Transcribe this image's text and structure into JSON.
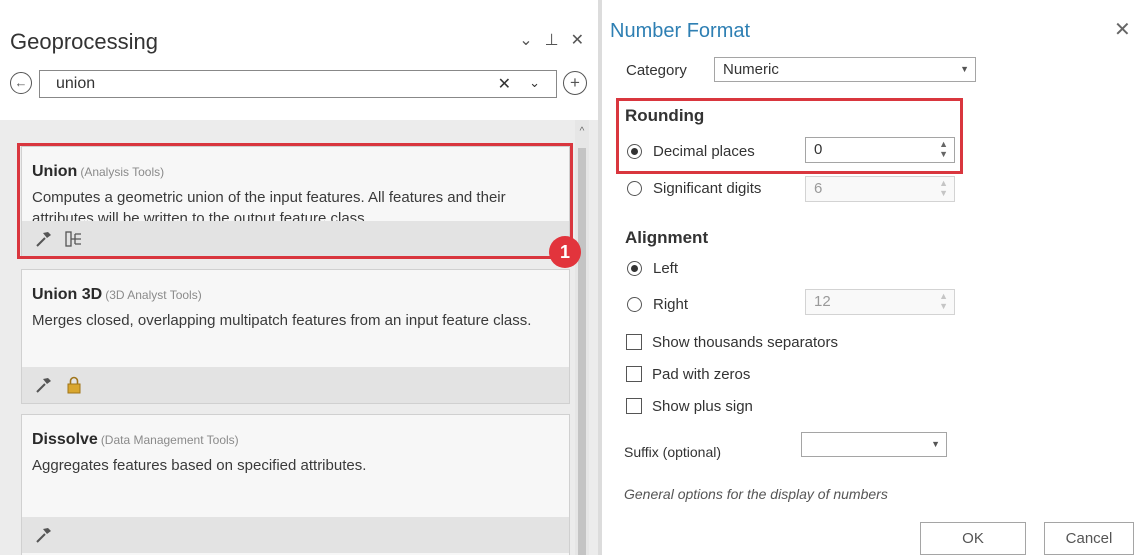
{
  "geoprocessing": {
    "title": "Geoprocessing",
    "controls": {
      "options_icon": "⌄",
      "pin_icon": "⊥",
      "close_icon": "✕"
    },
    "back_icon": "←",
    "add_icon": "+",
    "search": {
      "value": "union",
      "clear_icon": "✕",
      "dropdown_icon": "⌄"
    },
    "results": [
      {
        "name": "Union",
        "toolbox": "(Analysis Tools)",
        "description": "Computes a geometric union of the input features. All features and their attributes will be written to the output feature class.",
        "icons": [
          "hammer-icon",
          "model-icon"
        ]
      },
      {
        "name": "Union 3D",
        "toolbox": "(3D Analyst Tools)",
        "description": "Merges closed, overlapping multipatch features from an input feature class.",
        "icons": [
          "hammer-icon",
          "lock-icon"
        ]
      },
      {
        "name": "Dissolve",
        "toolbox": "(Data Management Tools)",
        "description": "Aggregates features based on specified attributes.",
        "icons": [
          "hammer-icon"
        ]
      }
    ],
    "callout_badge": "1"
  },
  "number_format": {
    "title": "Number Format",
    "close_icon": "✕",
    "category_label": "Category",
    "category_value": "Numeric",
    "rounding": {
      "heading": "Rounding",
      "decimal_places_label": "Decimal places",
      "decimal_places_value": "0",
      "significant_digits_label": "Significant digits",
      "significant_digits_value": "6",
      "selected": "decimal_places"
    },
    "alignment": {
      "heading": "Alignment",
      "left_label": "Left",
      "right_label": "Right",
      "right_width_value": "12",
      "selected": "left"
    },
    "checkboxes": [
      {
        "label": "Show thousands separators",
        "checked": false
      },
      {
        "label": "Pad with zeros",
        "checked": false
      },
      {
        "label": "Show plus sign",
        "checked": false
      }
    ],
    "suffix_label": "Suffix (optional)",
    "suffix_value": "",
    "hint": "General options for the display of numbers",
    "ok_label": "OK",
    "cancel_label": "Cancel"
  },
  "colors": {
    "highlight": "#d9363e",
    "title_blue": "#2e7fb3",
    "badge": "#e2343c"
  }
}
